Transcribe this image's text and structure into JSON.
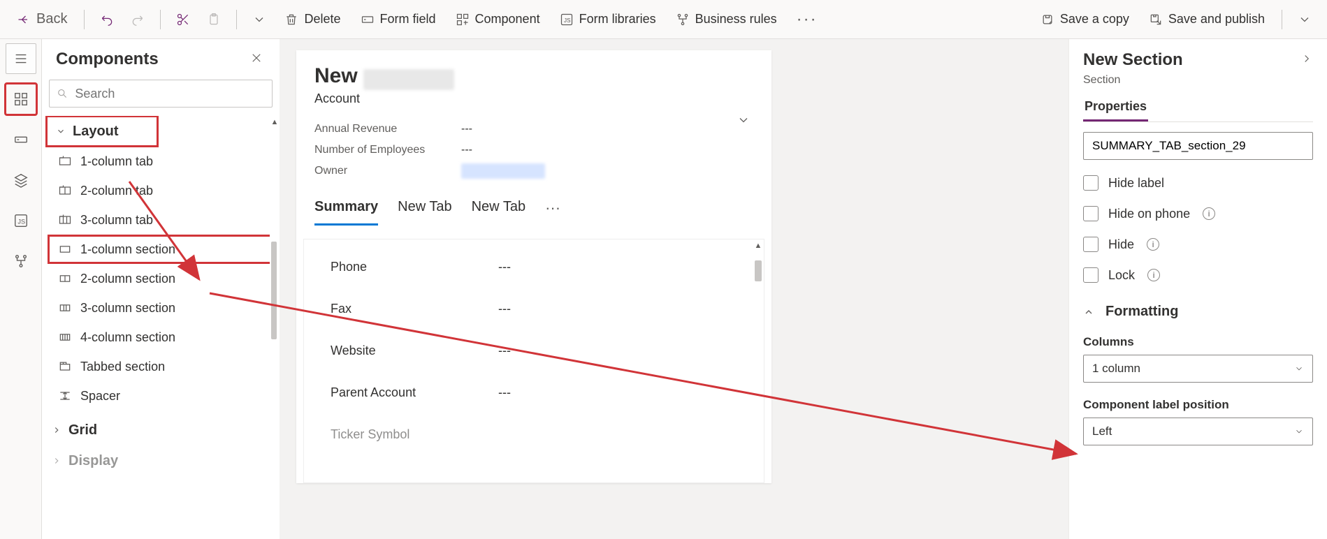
{
  "toolbar": {
    "back": "Back",
    "delete": "Delete",
    "form_field": "Form field",
    "component": "Component",
    "form_libraries": "Form libraries",
    "business_rules": "Business rules",
    "save_copy": "Save a copy",
    "save_publish": "Save and publish"
  },
  "components": {
    "title": "Components",
    "search_placeholder": "Search",
    "group_layout": "Layout",
    "items_layout": [
      "1-column tab",
      "2-column tab",
      "3-column tab",
      "1-column section",
      "2-column section",
      "3-column section",
      "4-column section",
      "Tabbed section",
      "Spacer"
    ],
    "group_grid": "Grid",
    "group_display": "Display"
  },
  "form": {
    "title_prefix": "New",
    "entity": "Account",
    "header_fields": [
      {
        "label": "Annual Revenue",
        "value": "---"
      },
      {
        "label": "Number of Employees",
        "value": "---"
      },
      {
        "label": "Owner",
        "value": ""
      }
    ],
    "tabs": [
      "Summary",
      "New Tab",
      "New Tab"
    ],
    "body_fields": [
      {
        "label": "Phone",
        "value": "---"
      },
      {
        "label": "Fax",
        "value": "---"
      },
      {
        "label": "Website",
        "value": "---"
      },
      {
        "label": "Parent Account",
        "value": "---"
      },
      {
        "label": "Ticker Symbol",
        "value": ""
      }
    ]
  },
  "properties": {
    "title": "New Section",
    "subtitle": "Section",
    "tab": "Properties",
    "name_value": "SUMMARY_TAB_section_29",
    "checks": [
      "Hide label",
      "Hide on phone",
      "Hide",
      "Lock"
    ],
    "formatting": "Formatting",
    "columns_label": "Columns",
    "columns_value": "1 column",
    "label_pos_label": "Component label position",
    "label_pos_value": "Left"
  }
}
